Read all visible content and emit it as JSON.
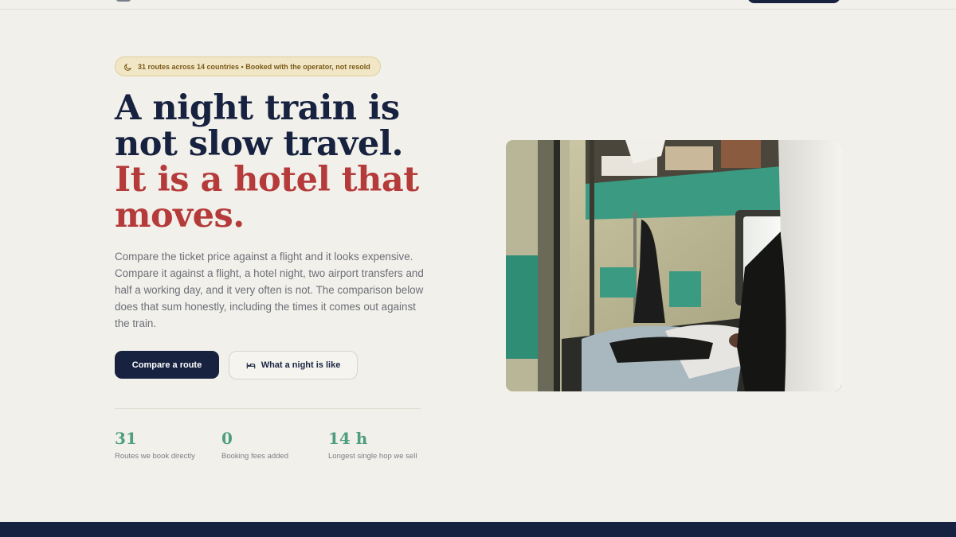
{
  "badge": {
    "text": "31 routes across 14 countries • Booked with the operator, not resold",
    "icon": "moon-icon"
  },
  "headline": {
    "line1": "A night train is",
    "line2": "not slow travel.",
    "line3": "It is a hotel that",
    "line4": "moves."
  },
  "lede": "Compare the ticket price against a flight and it looks expensive. Compare it against a flight, a hotel night, two airport transfers and half a working day, and it very often is not. The comparison below does that sum honestly, including the times it comes out against the train.",
  "buttons": {
    "primary": "Compare a route",
    "secondary": "What a night is like",
    "secondary_icon": "bed-icon"
  },
  "stats": [
    {
      "value": "31",
      "label": "Routes we book directly"
    },
    {
      "value": "0",
      "label": "Booking fees added"
    },
    {
      "value": "14 h",
      "label": "Longest single hop we sell"
    }
  ],
  "colors": {
    "background": "#f2f0ea",
    "navy": "#16223f",
    "accent_red": "#b53a3a",
    "accent_green": "#4e9e82",
    "badge_bg": "#f1e6c6"
  }
}
